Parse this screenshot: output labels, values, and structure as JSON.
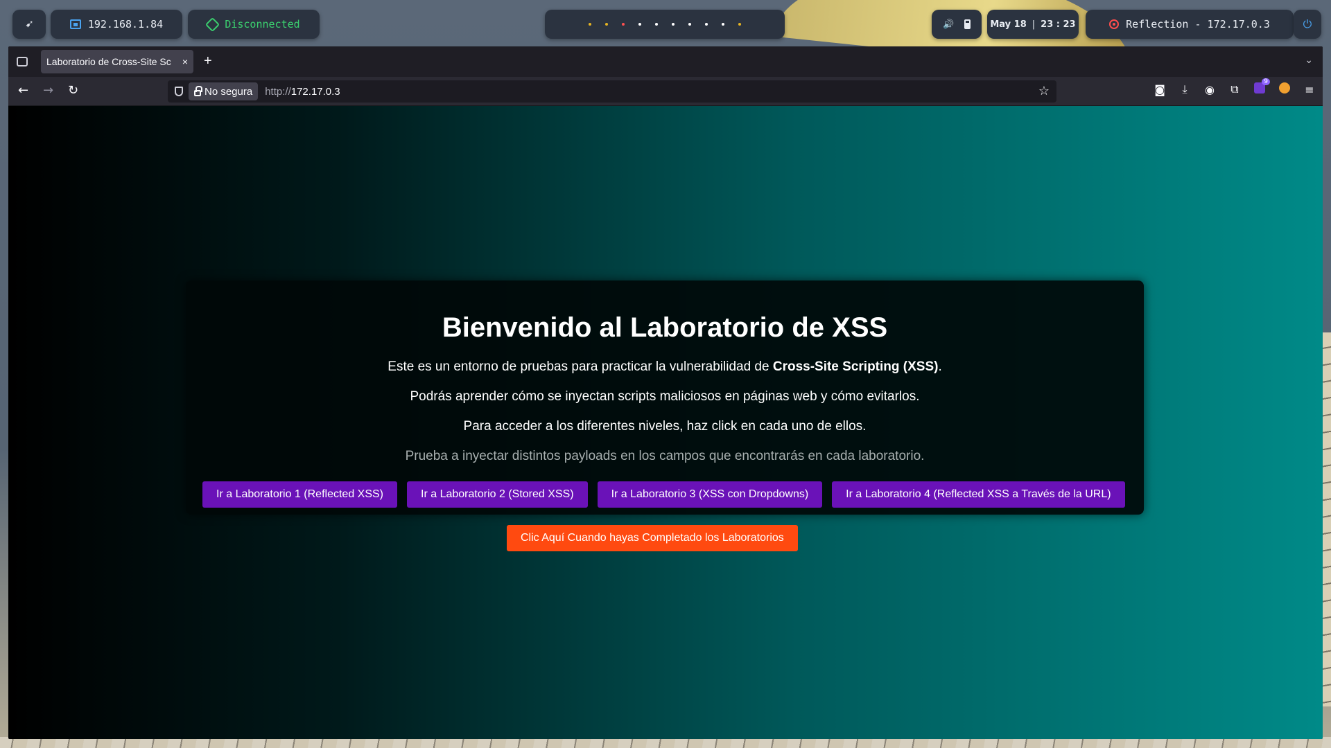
{
  "topbar": {
    "ip": "192.168.1.84",
    "vpn_status": "Disconnected",
    "workspace_dots": [
      "#e6b422",
      "#e6b422",
      "#ff5050",
      "#ffffff",
      "#ffffff",
      "#ffffff",
      "#ffffff",
      "#ffffff",
      "#ffffff",
      "#e6b422"
    ],
    "date": "May 18",
    "time": "23 : 23",
    "target": "Reflection - 172.17.0.3"
  },
  "browser": {
    "tab_title": "Laboratorio de Cross-Site Sc",
    "tab_close": "×",
    "new_tab": "+",
    "security_label": "No segura",
    "url_scheme": "http://",
    "url_host": "172.17.0.3",
    "extension_badge": "9"
  },
  "page": {
    "heading": "Bienvenido al Laboratorio de XSS",
    "intro_before": "Este es un entorno de pruebas para practicar la vulnerabilidad de ",
    "intro_bold": "Cross-Site Scripting (XSS)",
    "intro_after": ".",
    "line2": "Podrás aprender cómo se inyectan scripts maliciosos en páginas web y cómo evitarlos.",
    "line3": "Para acceder a los diferentes niveles, haz click en cada uno de ellos.",
    "line4": "Prueba a inyectar distintos payloads en los campos que encontrarás en cada laboratorio.",
    "lab_buttons": [
      "Ir a Laboratorio 1 (Reflected XSS)",
      "Ir a Laboratorio 2 (Stored XSS)",
      "Ir a Laboratorio 3 (XSS con Dropdowns)",
      "Ir a Laboratorio 4 (Reflected XSS a Través de la URL)"
    ],
    "done_button": "Clic Aquí Cuando hayas Completado los Laboratorios"
  },
  "colors": {
    "lab_button": "#6a12b8",
    "done_button": "#ff4a10",
    "gradient_end": "#008a88"
  }
}
